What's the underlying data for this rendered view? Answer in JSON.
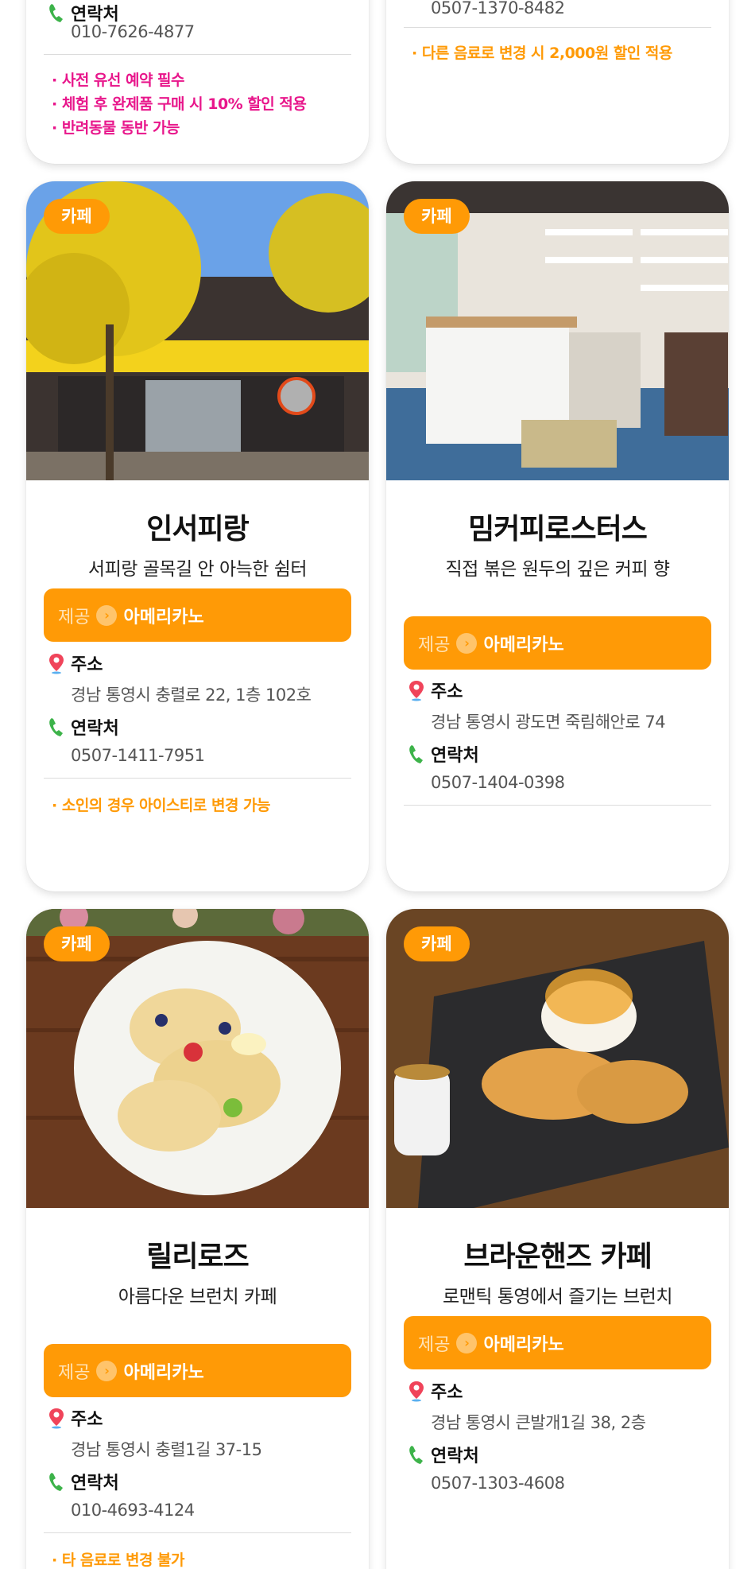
{
  "top_left": {
    "contact_label": "연락처",
    "contact": "010-7626-4877",
    "notes": [
      "· 사전 유선 예약 필수",
      "· 체험 후 완제품 구매 시 10% 할인 적용",
      "· 반려동물 동반 가능"
    ],
    "note_color": "#e8168b"
  },
  "top_right": {
    "contact": "0507-1370-8482",
    "note": "· 다른 음료로 변경 시 2,000원 할인 적용",
    "note_color": "#ff9a06"
  },
  "labels": {
    "badge": "카페",
    "offer_label": "제공",
    "address": "주소",
    "contact": "연락처"
  },
  "cards": [
    {
      "name": "인서피랑",
      "tagline": "서피랑 골목길 안 아늑한 쉼터",
      "offer": "아메리카노",
      "address": "경남 통영시 충렬로 22, 1층 102호",
      "contact": "0507-1411-7951",
      "note": "· 소인의 경우 아이스티로 변경 가능",
      "photo": "yellow-tree-storefront"
    },
    {
      "name": "밈커피로스터스",
      "tagline": "직접 볶은 원두의 깊은 커피 향",
      "offer": "아메리카노",
      "address": "경남 통영시 광도면 죽림해안로 74",
      "contact": "0507-1404-0398",
      "note": "",
      "photo": "cafe-interior-counter"
    },
    {
      "name": "릴리로즈",
      "tagline": "아름다운 브런치 카페",
      "offer": "아메리카노",
      "address": "경남 통영시 충렬1길 37-15",
      "contact": "010-4693-4124",
      "note": "· 타 음료로 변경 불가",
      "photo": "fruit-pancakes"
    },
    {
      "name": "브라운핸즈 카페",
      "tagline": "로맨틱 통영에서 즐기는 브런치",
      "offer": "아메리카노",
      "address": "경남 통영시 큰발개1길 38, 2층",
      "contact": "0507-1303-4608",
      "note": "",
      "photo": "waffle-ice-cream"
    }
  ],
  "colors": {
    "accent": "#ff9a06",
    "pink": "#e8168b",
    "pin": "#f0445a",
    "phone": "#3db34a"
  }
}
